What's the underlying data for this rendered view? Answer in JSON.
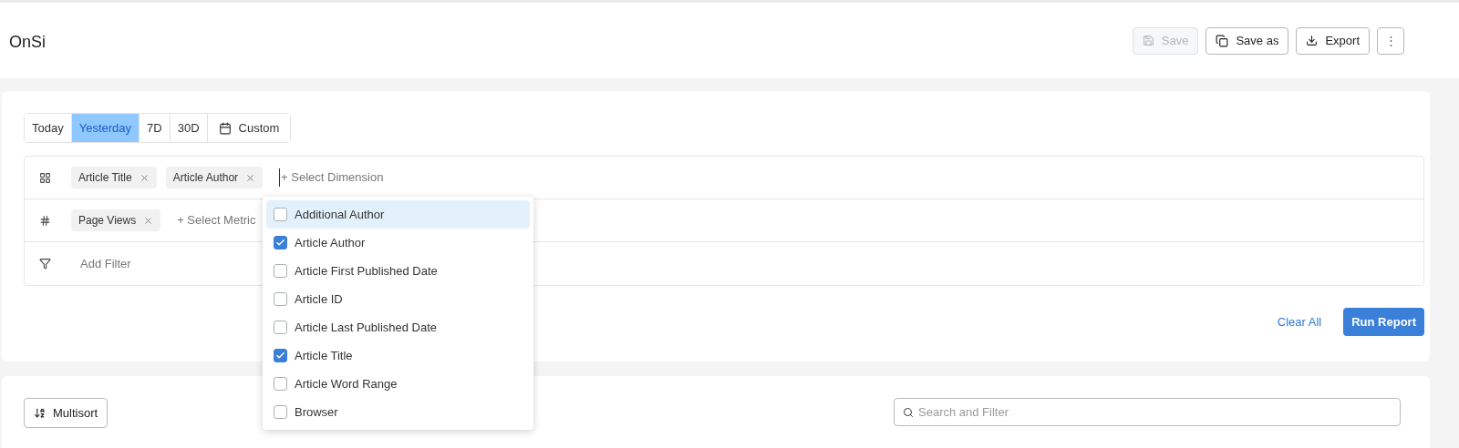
{
  "header": {
    "title": "OnSi",
    "actions": [
      {
        "label": "Save",
        "kind": "save",
        "disabled": true
      },
      {
        "label": "Save as",
        "kind": "copy",
        "disabled": false
      },
      {
        "label": "Export",
        "kind": "download",
        "disabled": false
      }
    ],
    "more": "⋮"
  },
  "date_ranges": [
    {
      "label": "Today",
      "selected": false
    },
    {
      "label": "Yesterday",
      "selected": true
    },
    {
      "label": "7D",
      "selected": false
    },
    {
      "label": "30D",
      "selected": false
    },
    {
      "label": "Custom",
      "selected": false,
      "kind": "calendar"
    }
  ],
  "builder": {
    "dimensions": {
      "chips": [
        "Article Title",
        "Article Author"
      ],
      "placeholder": "+ Select Dimension"
    },
    "metrics": {
      "chips": [
        "Page Views"
      ],
      "placeholder": "+ Select Metric"
    },
    "filters": {
      "placeholder": "Add Filter"
    }
  },
  "dimension_menu": [
    {
      "label": "Additional Author",
      "checked": false,
      "selected": true
    },
    {
      "label": "Article Author",
      "checked": true,
      "selected": false
    },
    {
      "label": "Article First Published Date",
      "checked": false,
      "selected": false
    },
    {
      "label": "Article ID",
      "checked": false,
      "selected": false
    },
    {
      "label": "Article Last Published Date",
      "checked": false,
      "selected": false
    },
    {
      "label": "Article Title",
      "checked": true,
      "selected": false
    },
    {
      "label": "Article Word Range",
      "checked": false,
      "selected": false
    },
    {
      "label": "Browser",
      "checked": false,
      "selected": false
    }
  ],
  "report_actions": {
    "clear": "Clear All",
    "run": "Run Report"
  },
  "table_toolbar": {
    "multisort": "Multisort",
    "search": {
      "placeholder": "Search and Filter"
    }
  }
}
